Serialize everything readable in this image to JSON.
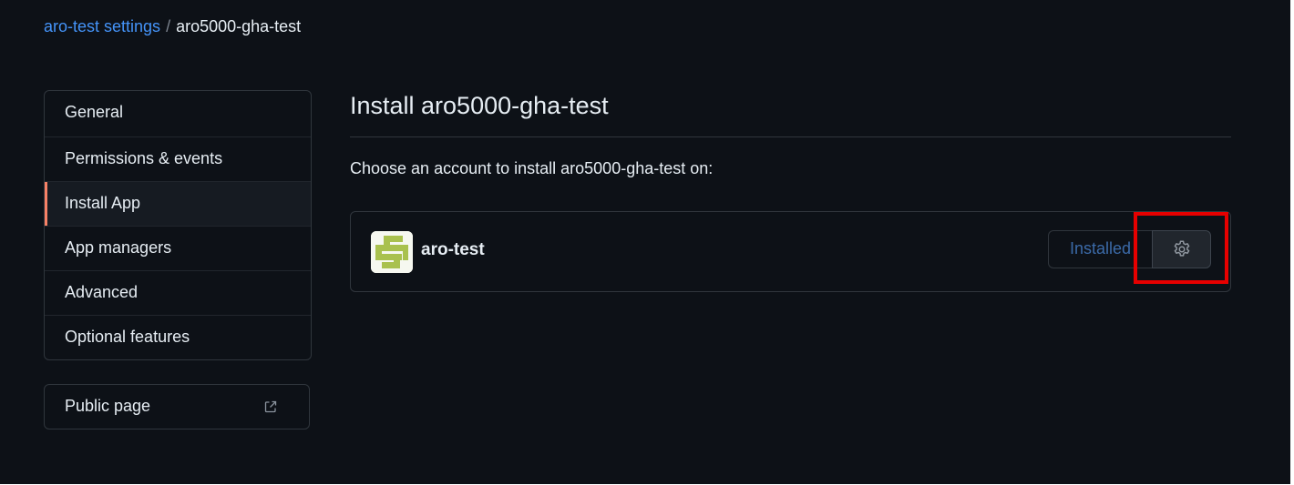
{
  "breadcrumb": {
    "parent": "aro-test settings",
    "separator": "/",
    "current": "aro5000-gha-test"
  },
  "sidebar": {
    "items": [
      {
        "label": "General"
      },
      {
        "label": "Permissions & events"
      },
      {
        "label": "Install App",
        "selected": true
      },
      {
        "label": "App managers"
      },
      {
        "label": "Advanced"
      },
      {
        "label": "Optional features"
      }
    ],
    "public_page": {
      "label": "Public page",
      "icon": "external-link-icon"
    }
  },
  "main": {
    "title": "Install aro5000-gha-test",
    "prompt": "Choose an account to install aro5000-gha-test on:",
    "account": {
      "name": "aro-test",
      "status_label": "Installed",
      "settings_icon": "gear-icon"
    }
  },
  "colors": {
    "background": "#0d1117",
    "link": "#4493f8",
    "selected_accent": "#f78166",
    "highlight": "#e60000",
    "avatar_green": "#a9c14e"
  }
}
